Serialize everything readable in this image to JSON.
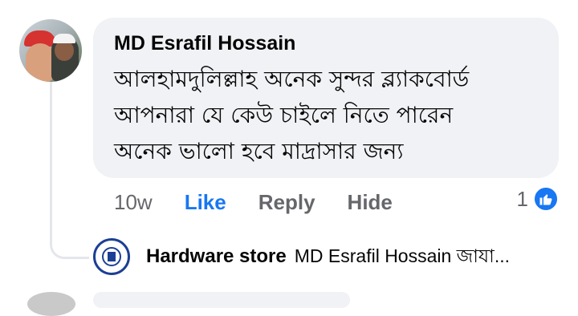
{
  "comment": {
    "author": "MD Esrafil Hossain",
    "text": "আলহামদুলিল্লাহ অনেক সুন্দর ব্ল্যাকবোর্ড\nআপনারা যে কেউ চাইলে নিতে পারেন\nঅনেক ভালো হবে মাদ্রাসার জন্য"
  },
  "actions": {
    "timestamp": "10w",
    "like": "Like",
    "reply": "Reply",
    "hide": "Hide"
  },
  "reactions": {
    "count": "1",
    "icon": "thumbs-up-icon",
    "color": "#1877f2"
  },
  "reply": {
    "author": "Hardware store",
    "preview": "MD Esrafil Hossain জাযা..."
  }
}
